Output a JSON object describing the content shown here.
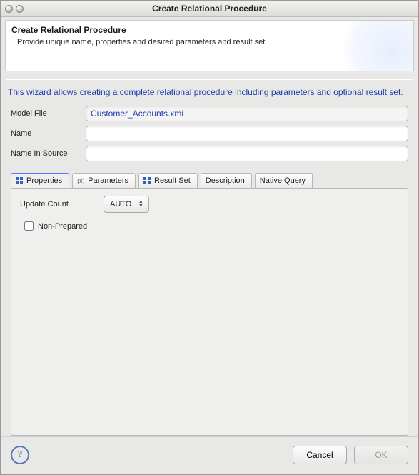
{
  "window_title": "Create Relational Procedure",
  "header": {
    "title": "Create Relational Procedure",
    "subtitle": "Provide unique name, properties and desired parameters and result set"
  },
  "wizard_description": "This wizard allows creating a complete relational procedure including parameters and optional result set.",
  "fields": {
    "model_file": {
      "label": "Model File",
      "value": "Customer_Accounts.xmi"
    },
    "name": {
      "label": "Name",
      "value": ""
    },
    "name_in_source": {
      "label": "Name In Source",
      "value": ""
    }
  },
  "tabs": {
    "properties": "Properties",
    "parameters": "Parameters",
    "result_set": "Result Set",
    "description": "Description",
    "native_query": "Native Query"
  },
  "properties_panel": {
    "update_count_label": "Update Count",
    "update_count_value": "AUTO",
    "non_prepared_label": "Non-Prepared",
    "non_prepared_checked": false
  },
  "footer": {
    "cancel": "Cancel",
    "ok": "OK"
  }
}
